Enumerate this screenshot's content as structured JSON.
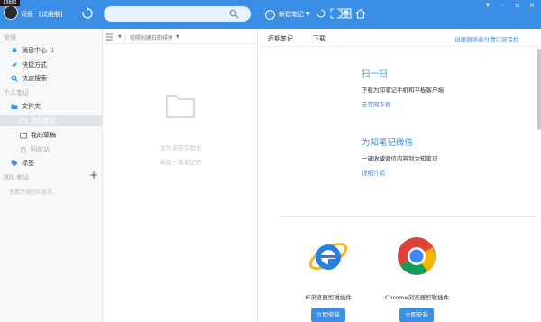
{
  "user": {
    "avatar_badge": "89881",
    "name": "司鱼",
    "trial": "[试用期]"
  },
  "search": {
    "placeholder": ""
  },
  "toolbar": {
    "new_note_label": "新建笔记"
  },
  "sidebar": {
    "common_label": "常用",
    "message_center": {
      "label": "消息中心",
      "count": "1"
    },
    "shortcuts": "快捷方式",
    "quick_search": "快速搜索",
    "personal_label": "个人笔记",
    "folders": "文件夹",
    "my_notes": "我的笔记",
    "my_drafts": "我的草稿",
    "recycle_bin": "回收站",
    "tags": "标签",
    "team_label": "团队笔记",
    "team_empty": "免费开通团队服务..."
  },
  "note_list": {
    "sort_label": "按照创建日期排序",
    "empty_line1": "文件夹空空如也",
    "empty_line2": "新建一篇笔记吧"
  },
  "main": {
    "tabs": [
      "近期笔记",
      "下载"
    ],
    "promo_link": "创建微读者付费订阅专栏",
    "scan": {
      "title": "扫一扫",
      "desc": "下载为知笔记手机和平板客户端",
      "link": "去官网下载"
    },
    "wechat": {
      "title": "为知笔记微信",
      "desc": "一键收藏微信内容到为知笔记",
      "link": "详细介绍"
    },
    "browsers": [
      {
        "name": "IE浏览器剪辑插件",
        "button": "立即安装",
        "icon": "ie-icon"
      },
      {
        "name": "Chrome浏览器剪辑插件",
        "button": "立即安装",
        "icon": "chrome-icon"
      }
    ]
  },
  "colors": {
    "accent": "#3a8ee6",
    "sidebar_bg": "#f7f8fa",
    "active_item": "#dfe4ea"
  }
}
